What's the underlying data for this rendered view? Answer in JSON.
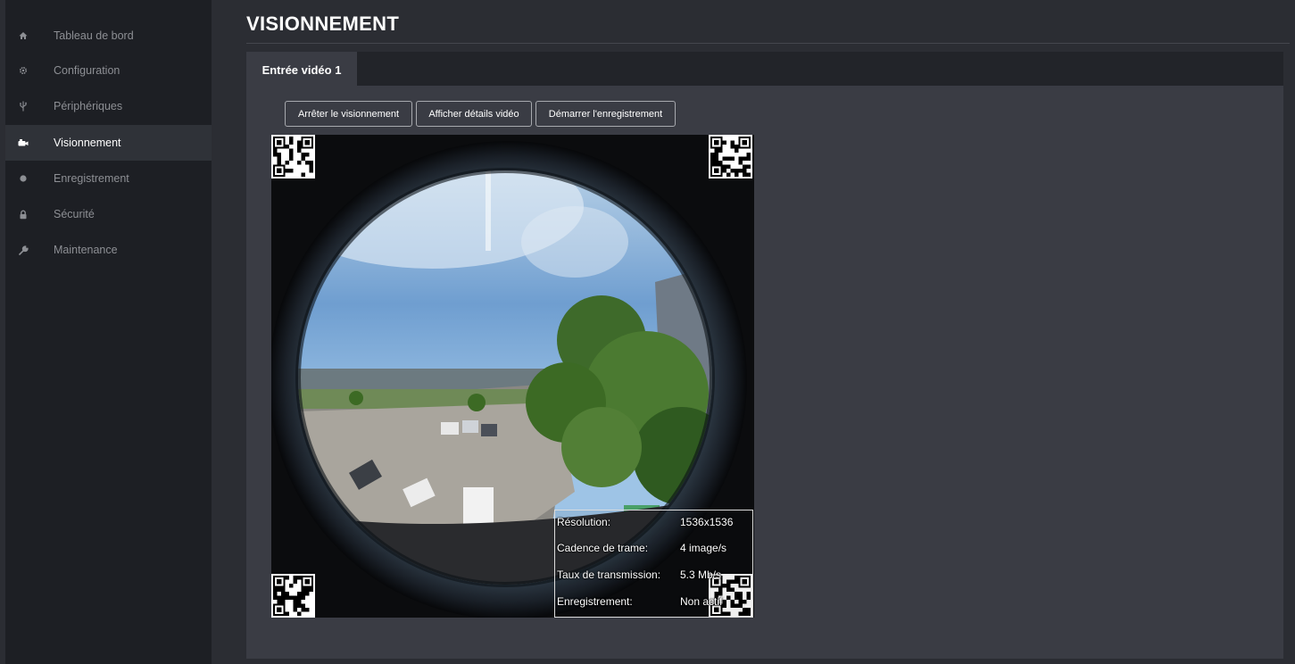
{
  "sidebar": {
    "items": [
      {
        "label": "Tableau de bord",
        "icon": "home-icon"
      },
      {
        "label": "Configuration",
        "icon": "gear-icon"
      },
      {
        "label": "Périphériques",
        "icon": "usb-icon"
      },
      {
        "label": "Visionnement",
        "icon": "video-camera-icon"
      },
      {
        "label": "Enregistrement",
        "icon": "record-dot-icon"
      },
      {
        "label": "Sécurité",
        "icon": "lock-icon"
      },
      {
        "label": "Maintenance",
        "icon": "wrench-icon"
      }
    ],
    "active_index": 3
  },
  "header": {
    "title": "VISIONNEMENT"
  },
  "main": {
    "tabs": [
      {
        "label": "Entrée vidéo 1"
      }
    ],
    "toolbar": {
      "stop_view_label": "Arrêter le visionnement",
      "show_details_label": "Afficher détails vidéo",
      "start_record_label": "Démarrer l'enregistrement"
    },
    "video_details": [
      {
        "label": "Résolution:",
        "value": "1536x1536"
      },
      {
        "label": "Cadence de trame:",
        "value": "4 image/s"
      },
      {
        "label": "Taux de transmission:",
        "value": "5.3 Mb/s"
      },
      {
        "label": "Enregistrement:",
        "value": "Non actif"
      }
    ]
  },
  "colors": {
    "background": "#2b2d33",
    "sidebar": "#1d1f24",
    "sidebar_active": "#2f3238",
    "panel": "#3a3c44",
    "text_muted": "#8d8f94",
    "text_active": "#ffffff"
  }
}
